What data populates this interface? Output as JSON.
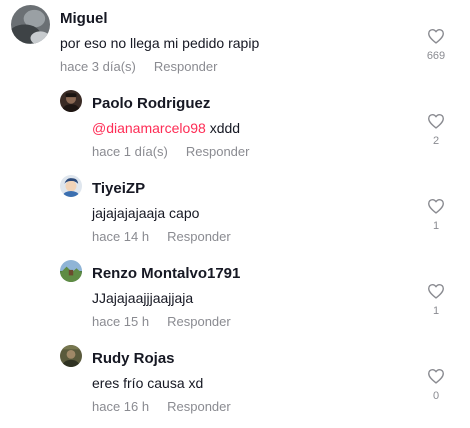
{
  "comments": [
    {
      "username": "Miguel",
      "mention": "",
      "text": "por eso no llega mi pedido rapip",
      "time": "hace 3 día(s)",
      "reply_label": "Responder",
      "likes": "669",
      "avatar_icon": "gray-profile-photo"
    },
    {
      "username": "Paolo Rodriguez",
      "mention": "@dianamarcelo98",
      "text": " xddd",
      "time": "hace 1 día(s)",
      "reply_label": "Responder",
      "likes": "2",
      "avatar_icon": "dark-profile-photo"
    },
    {
      "username": "TiyeiZP",
      "mention": "",
      "text": "jajajajajaaja capo",
      "time": "hace 14 h",
      "reply_label": "Responder",
      "likes": "1",
      "avatar_icon": "cartoon-profile-photo"
    },
    {
      "username": "Renzo Montalvo1791",
      "mention": "",
      "text": "JJajajaajjjaajjaja",
      "time": "hace 15 h",
      "reply_label": "Responder",
      "likes": "1",
      "avatar_icon": "landscape-profile-photo"
    },
    {
      "username": "Rudy Rojas",
      "mention": "",
      "text": "eres frío causa xd",
      "time": "hace 16 h",
      "reply_label": "Responder",
      "likes": "0",
      "avatar_icon": "olive-profile-photo"
    }
  ],
  "colors": {
    "mention": "#fe2c55",
    "meta": "#8a8b91",
    "text": "#161823"
  },
  "like_icon": "heart-outline-icon"
}
